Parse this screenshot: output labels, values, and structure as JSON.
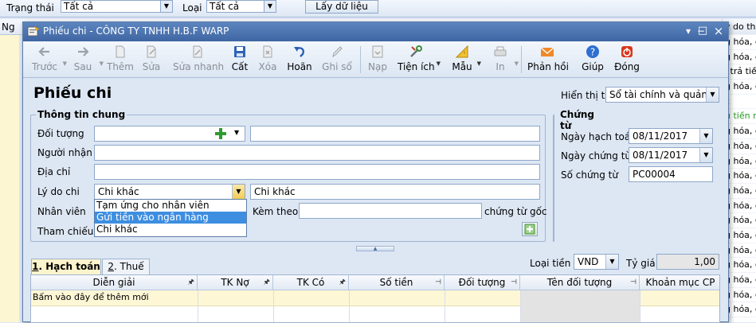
{
  "background": {
    "status_label": "Trạng thái",
    "status_value": "Tất cả",
    "type_label": "Loại",
    "type_value": "Tất cả",
    "fetch_button": "Lấy dữ liệu",
    "grid_col_left": "Ng",
    "side_column": [
      "ý do thu",
      "g hóa, c",
      "g hóa, c",
      "i trả tiề",
      "g hóa, c",
      "c",
      "u tiền m",
      "g hóa, c",
      "g hóa, c",
      "g hóa, c",
      "g hóa, c",
      "g hóa, c",
      "g hóa, c",
      "g hóa, c",
      "g hóa, c",
      "g hóa, c",
      "g hóa, c",
      "g hóa, c",
      "g hóa, c",
      "g hóa, c"
    ]
  },
  "window": {
    "title": "Phiếu chi - CÔNG TY TNHH H.B.F WARP",
    "btn_minimize": "−",
    "btn_maximize": "□",
    "btn_close": "×"
  },
  "toolbar": {
    "prev": "Trước",
    "next": "Sau",
    "add": "Thêm",
    "edit": "Sửa",
    "quick_edit": "Sửa nhanh",
    "save": "Cất",
    "delete": "Xóa",
    "undo": "Hoãn",
    "post": "Ghi sổ",
    "load": "Nạp",
    "utilities": "Tiện ích",
    "template": "Mẫu",
    "print": "In",
    "feedback": "Phản hồi",
    "help": "Giúp",
    "close": "Đóng"
  },
  "form": {
    "title": "Phiếu chi",
    "show_on_book_label": "Hiển thị trên sổ",
    "show_on_book_value": "Sổ tài chính và quản trị",
    "general_info_title": "Thông tin chung",
    "object_label": "Đối tượng",
    "object_value": "",
    "object_name_value": "",
    "receiver_label": "Người nhận",
    "receiver_value": "",
    "address_label": "Địa chỉ",
    "address_value": "",
    "reason_label": "Lý do chi",
    "reason_value": "Chi khác",
    "reason_text": "Chi khác",
    "employee_label": "Nhân viên",
    "attached_label": "Kèm theo",
    "attached_value": "",
    "original_docs_label": "chứng từ gốc",
    "reference_label": "Tham chiếu",
    "reason_options": [
      "Tạm ứng cho nhân viên",
      "Gửi tiền vào ngân hàng",
      "Chi khác"
    ],
    "reason_selected_index": 1,
    "voucher_title": "Chứng từ",
    "posting_date_label": "Ngày hạch toán",
    "posting_date_value": "08/11/2017",
    "voucher_date_label": "Ngày chứng từ",
    "voucher_date_value": "08/11/2017",
    "voucher_no_label": "Số chứng từ",
    "voucher_no_value": "PC00004"
  },
  "detail": {
    "tab_accounting_num": "1",
    "tab_accounting": ". Hạch toán",
    "tab_tax_num": "2",
    "tab_tax": ". Thuế",
    "currency_label": "Loại tiền",
    "currency_value": "VND",
    "rate_label": "Tỷ giá",
    "rate_value": "1,00",
    "columns": [
      "Diễn giải",
      "TK Nợ",
      "TK Có",
      "Số tiền",
      "Đối tượng",
      "Tên đối tượng",
      "Khoản mục CP"
    ],
    "new_row_hint": "Bấm vào đây để thêm mới"
  },
  "colors": {
    "title_bar": "#4a72ad",
    "selection": "#3d8ee0",
    "new_row": "#fdf7d6",
    "active_tab": "#fbf4cc"
  }
}
